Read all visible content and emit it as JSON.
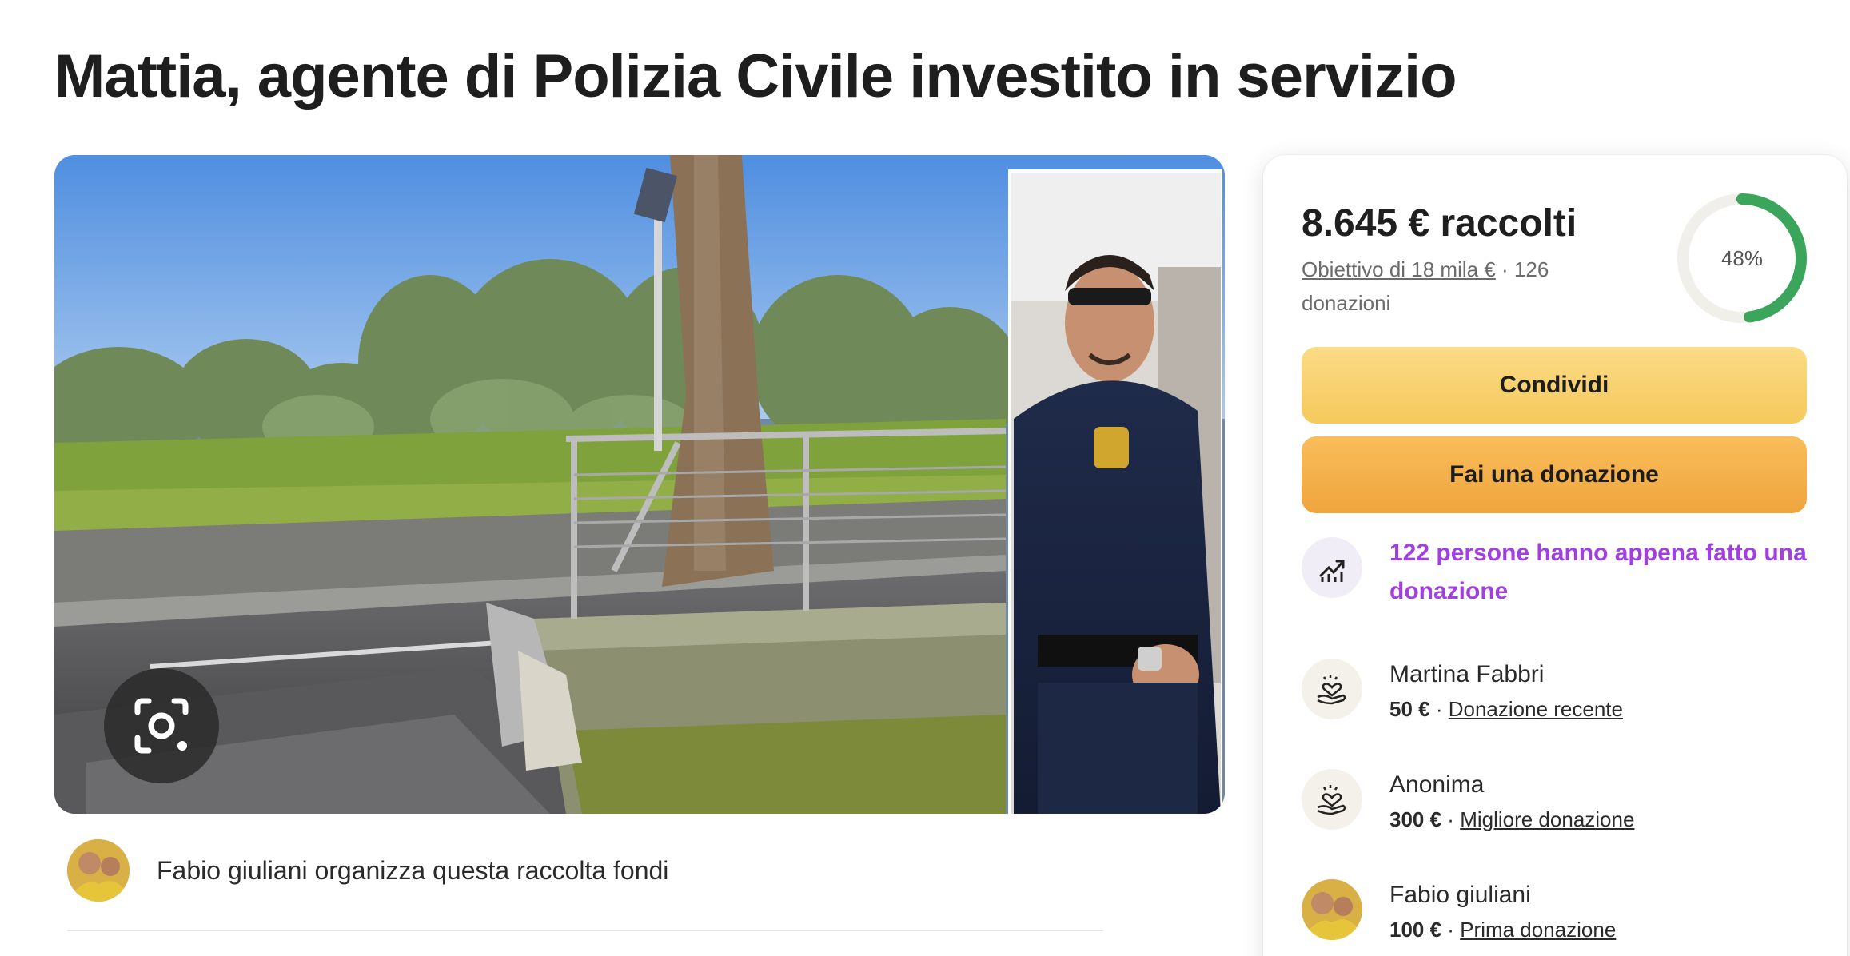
{
  "page": {
    "title": "Mattia, agente di Polizia Civile investito in servizio"
  },
  "organizer": {
    "text": "Fabio giuliani organizza questa raccolta fondi"
  },
  "summary": {
    "raised": "8.645 € raccolti",
    "goal_link": "Obiettivo di 18 mila €",
    "separator": " · ",
    "donations_count": "126 donazioni",
    "progress_percent": 48,
    "progress_label": "48%"
  },
  "buttons": {
    "share": "Condividi",
    "donate": "Fai una donazione"
  },
  "recent_activity": {
    "text": "122 persone hanno appena fatto una donazione"
  },
  "donors": [
    {
      "name": "Martina Fabbri",
      "amount": "50 €",
      "separator": " · ",
      "tag": "Donazione recente",
      "icon": "heart-hand-icon"
    },
    {
      "name": "Anonima",
      "amount": "300 €",
      "separator": " · ",
      "tag": "Migliore donazione",
      "icon": "heart-hand-icon"
    },
    {
      "name": "Fabio giuliani",
      "amount": "100 €",
      "separator": " · ",
      "tag": "Prima donazione",
      "icon": "avatar"
    }
  ],
  "colors": {
    "accent_green": "#3aa55b",
    "activity_purple": "#a23fe0",
    "share_yellow": "#f7cf69",
    "donate_orange": "#f3ab45"
  }
}
